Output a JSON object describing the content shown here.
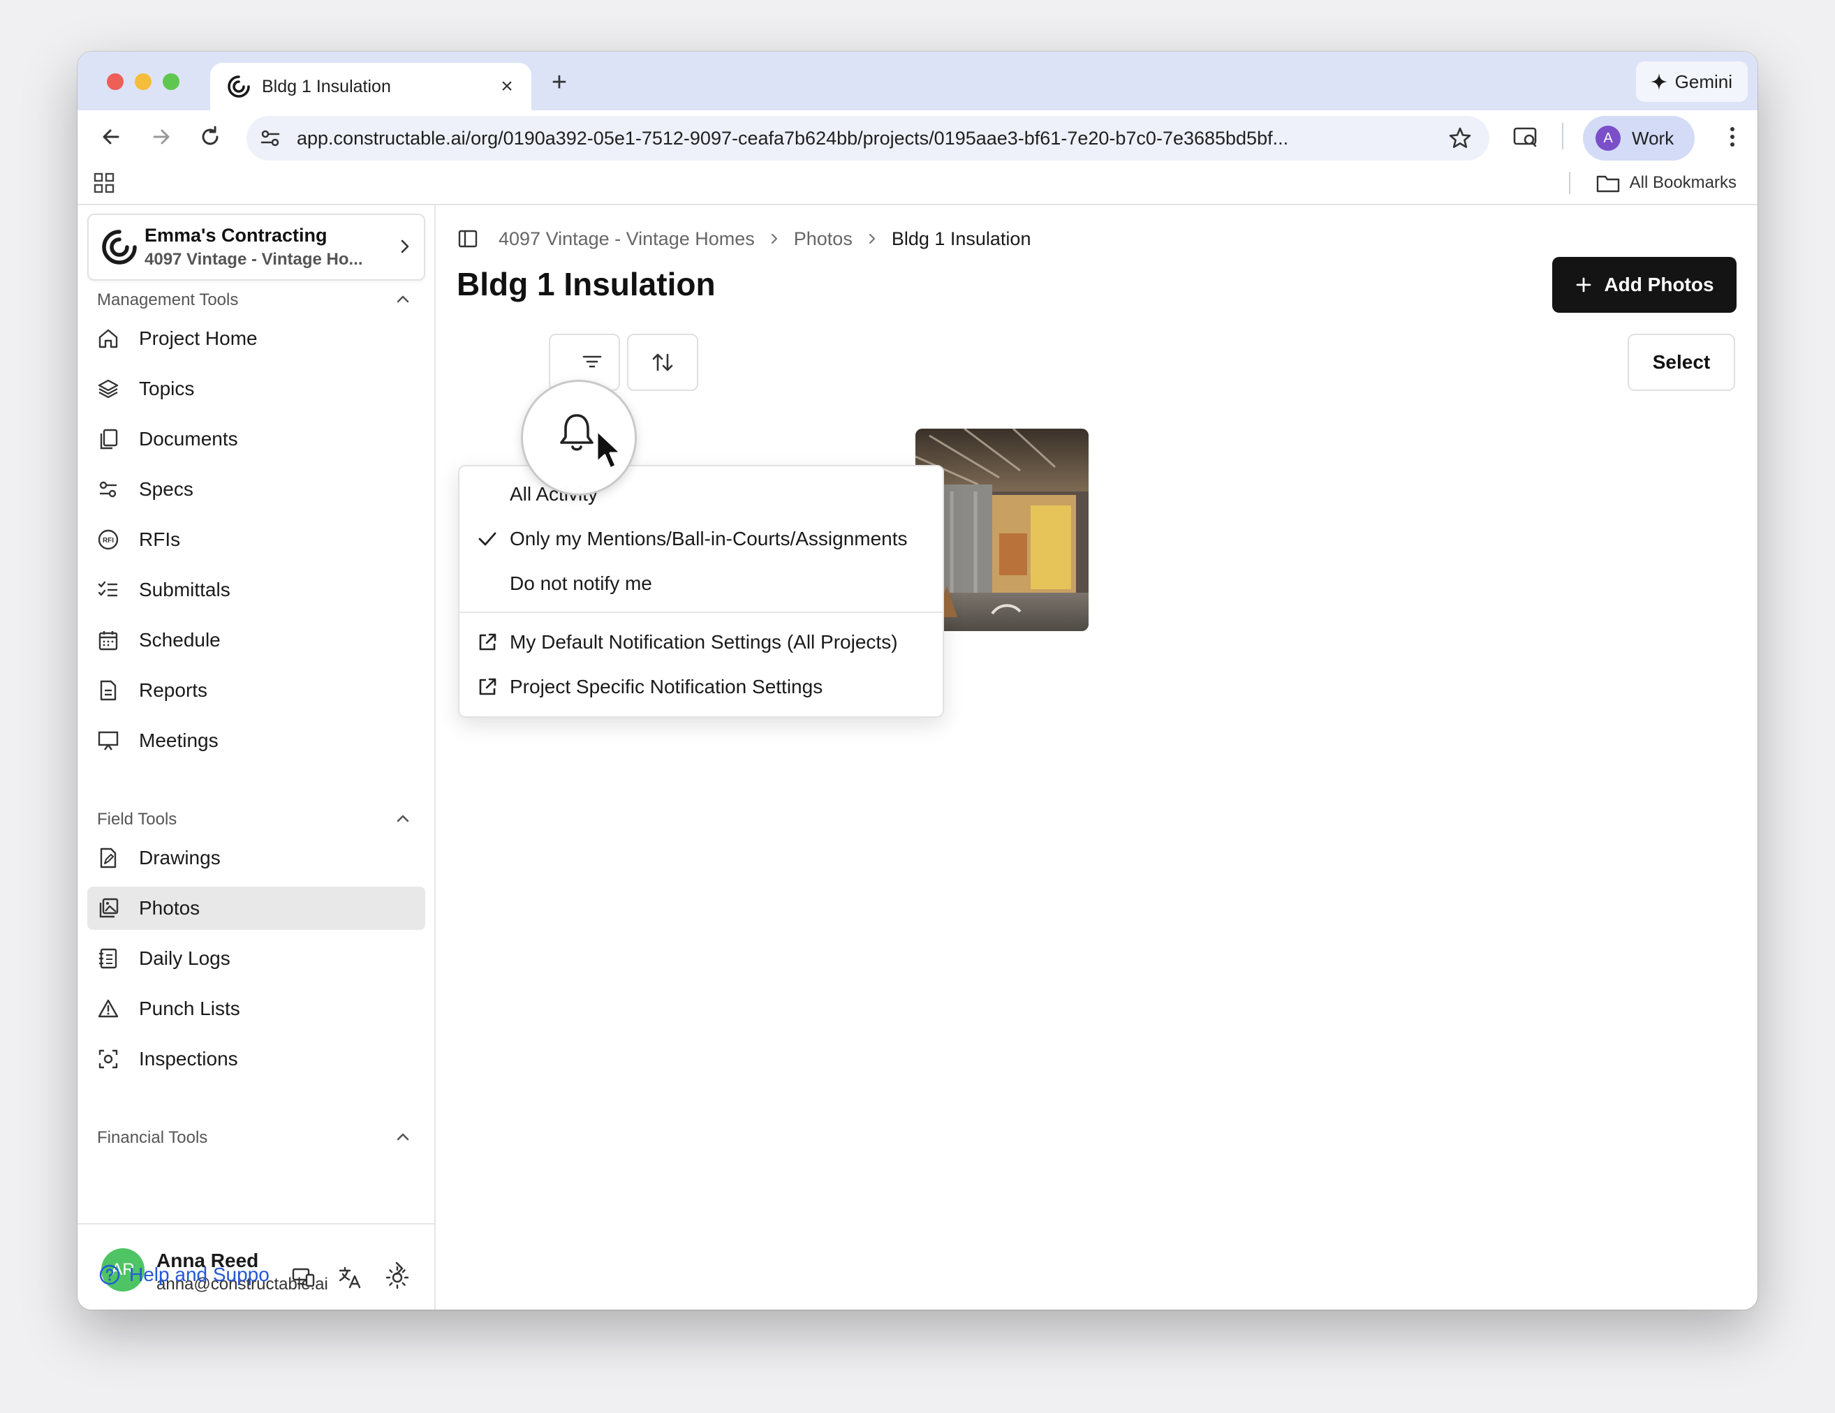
{
  "browser": {
    "tab_title": "Bldg 1 Insulation",
    "gemini_label": "Gemini",
    "url": "app.constructable.ai/org/0190a392-05e1-7512-9097-ceafa7b624bb/projects/0195aae3-bf61-7e20-b7c0-7e3685bd5bf...",
    "profile_initial": "A",
    "profile_label": "Work",
    "all_bookmarks": "All Bookmarks"
  },
  "org": {
    "name": "Emma's Contracting",
    "project": "4097 Vintage - Vintage Ho..."
  },
  "sidebar": {
    "management_header": "Management Tools",
    "management_items": [
      "Project Home",
      "Topics",
      "Documents",
      "Specs",
      "RFIs",
      "Submittals",
      "Schedule",
      "Reports",
      "Meetings"
    ],
    "field_header": "Field Tools",
    "field_items": [
      "Drawings",
      "Photos",
      "Daily Logs",
      "Punch Lists",
      "Inspections"
    ],
    "active_item": "Photos",
    "financial_header": "Financial Tools"
  },
  "user": {
    "initials": "AR",
    "name": "Anna Reed",
    "email": "anna@constructable.ai",
    "help_label": "Help and Suppo"
  },
  "main": {
    "breadcrumbs": [
      "4097 Vintage - Vintage Homes",
      "Photos",
      "Bldg 1 Insulation"
    ],
    "title": "Bldg 1 Insulation",
    "add_photos": "Add Photos",
    "select": "Select"
  },
  "notification_menu": {
    "options": [
      "All Activity",
      "Only my Mentions/Ball-in-Courts/Assignments",
      "Do not notify me"
    ],
    "selected": "Only my Mentions/Ball-in-Courts/Assignments",
    "links": [
      "My Default Notification Settings (All Projects)",
      "Project Specific Notification Settings"
    ]
  },
  "icons": {
    "accent": "#141414",
    "active_bg": "#e8e8e8",
    "avatar_green": "#4ec464",
    "link_blue": "#2457d6"
  }
}
